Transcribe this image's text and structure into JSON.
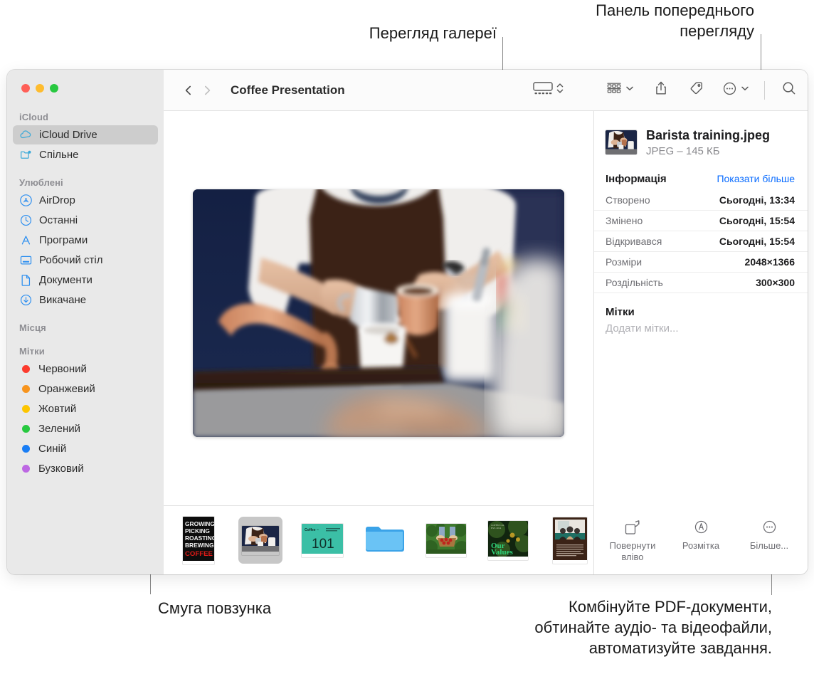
{
  "annotations": {
    "gallery_view": "Перегляд галереї",
    "preview_panel": "Панель попереднього\nперегляду",
    "scrubber_bar": "Смуга повзунка",
    "more_actions": "Комбінуйте PDF-документи,\nобтинайте аудіо- та відеофайли,\nавтоматизуйте завдання."
  },
  "window": {
    "title": "Coffee Presentation"
  },
  "sidebar": {
    "groups": [
      {
        "header": "iCloud",
        "items": [
          {
            "label": "iCloud Drive",
            "icon": "cloud-icon",
            "selected": true
          },
          {
            "label": "Спільне",
            "icon": "shared-folder-icon",
            "selected": false
          }
        ]
      },
      {
        "header": "Улюблені",
        "items": [
          {
            "label": "AirDrop",
            "icon": "airdrop-icon",
            "selected": false
          },
          {
            "label": "Останні",
            "icon": "clock-icon",
            "selected": false
          },
          {
            "label": "Програми",
            "icon": "applications-icon",
            "selected": false
          },
          {
            "label": "Робочий стіл",
            "icon": "desktop-icon",
            "selected": false
          },
          {
            "label": "Документи",
            "icon": "document-icon",
            "selected": false
          },
          {
            "label": "Викачане",
            "icon": "downloads-icon",
            "selected": false
          }
        ]
      },
      {
        "header": "Місця",
        "items": []
      },
      {
        "header": "Мітки",
        "items": [
          {
            "label": "Червоний",
            "icon": "tag-dot-icon",
            "color": "#fc3b2d",
            "selected": false
          },
          {
            "label": "Оранжевий",
            "icon": "tag-dot-icon",
            "color": "#f7941d",
            "selected": false
          },
          {
            "label": "Жовтий",
            "icon": "tag-dot-icon",
            "color": "#fdc500",
            "selected": false
          },
          {
            "label": "Зелений",
            "icon": "tag-dot-icon",
            "color": "#27c93f",
            "selected": false
          },
          {
            "label": "Синій",
            "icon": "tag-dot-icon",
            "color": "#1a7ef5",
            "selected": false
          },
          {
            "label": "Бузковий",
            "icon": "tag-dot-icon",
            "color": "#bd68e3",
            "selected": false
          }
        ]
      }
    ]
  },
  "toolbar": {
    "back_icon": "chevron-left-icon",
    "forward_icon": "chevron-right-icon",
    "view_gallery_icon": "gallery-view-icon",
    "view_stepper_icon": "chevron-up-down-icon",
    "arrange_icon": "group-items-icon",
    "arrange_chevron_icon": "chevron-down-icon",
    "share_icon": "share-icon",
    "tag_icon": "tag-icon",
    "more_icon": "ellipsis-circle-icon",
    "more_chevron_icon": "chevron-down-icon",
    "search_icon": "search-icon"
  },
  "preview": {
    "filename": "Barista training.jpeg",
    "filemeta": "JPEG – 145 КБ",
    "info_title": "Інформація",
    "show_more": "Показати більше",
    "rows": [
      {
        "key": "Створено",
        "value": "Сьогодні, 13:34"
      },
      {
        "key": "Змінено",
        "value": "Сьогодні, 15:54"
      },
      {
        "key": "Відкривався",
        "value": "Сьогодні, 15:54"
      },
      {
        "key": "Розміри",
        "value": "2048×1366"
      },
      {
        "key": "Роздільність",
        "value": "300×300"
      }
    ],
    "tags_title": "Мітки",
    "tags_placeholder": "Додати мітки...",
    "actions": [
      {
        "label": "Повернути\nвліво",
        "icon": "rotate-left-icon"
      },
      {
        "label": "Розмітка",
        "icon": "markup-icon"
      },
      {
        "label": "Більше...",
        "icon": "ellipsis-circle-icon"
      }
    ]
  },
  "filmstrip": {
    "items": [
      {
        "name": "coffee-poster-thumbnail",
        "kind": "poster",
        "selected": false
      },
      {
        "name": "barista-training-thumbnail",
        "kind": "photo-barista",
        "selected": true
      },
      {
        "name": "coffee-101-thumbnail",
        "kind": "slide-101",
        "selected": false
      },
      {
        "name": "folder-thumbnail",
        "kind": "folder",
        "selected": false
      },
      {
        "name": "coffee-cherries-thumbnail",
        "kind": "photo-berries",
        "selected": false
      },
      {
        "name": "our-values-thumbnail",
        "kind": "photo-values",
        "selected": false
      },
      {
        "name": "meeting-document-thumbnail",
        "kind": "doc-meeting",
        "selected": false
      },
      {
        "name": "invoice-thumbnail",
        "kind": "doc-invoice",
        "selected": false
      }
    ],
    "poster_lines": [
      "GROWING",
      "PICKING",
      "ROASTING",
      "BREWING",
      "COFFEE"
    ],
    "slide_title": "Coffee ~",
    "slide_number": "101",
    "values_title": "Our\nValues"
  },
  "colors": {
    "accent": "#0a84ff",
    "link": "#0a6cff",
    "sidebar_bg": "#e9e9e9",
    "selected_row": "#cdcdcd"
  }
}
